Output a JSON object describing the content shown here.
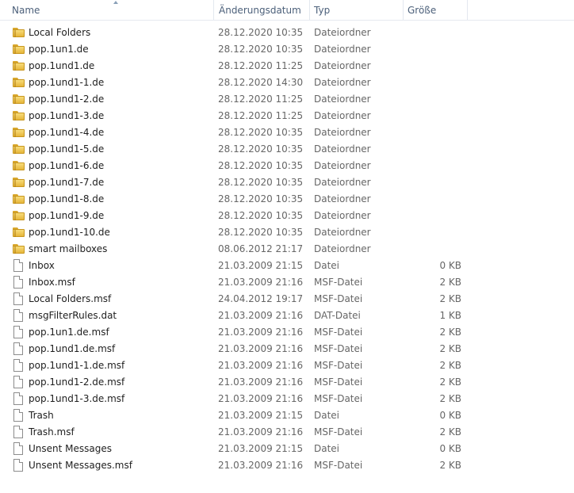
{
  "columns": {
    "name": "Name",
    "date": "Änderungsdatum",
    "type": "Typ",
    "size": "Größe"
  },
  "rows": [
    {
      "icon": "folder-icon",
      "name": "Local Folders",
      "date": "28.12.2020 10:35",
      "type": "Dateiordner",
      "size": ""
    },
    {
      "icon": "folder-icon",
      "name": "pop.1un1.de",
      "date": "28.12.2020 10:35",
      "type": "Dateiordner",
      "size": ""
    },
    {
      "icon": "folder-icon",
      "name": "pop.1und1.de",
      "date": "28.12.2020 11:25",
      "type": "Dateiordner",
      "size": ""
    },
    {
      "icon": "folder-icon",
      "name": "pop.1und1-1.de",
      "date": "28.12.2020 14:30",
      "type": "Dateiordner",
      "size": ""
    },
    {
      "icon": "folder-icon",
      "name": "pop.1und1-2.de",
      "date": "28.12.2020 11:25",
      "type": "Dateiordner",
      "size": ""
    },
    {
      "icon": "folder-icon",
      "name": "pop.1und1-3.de",
      "date": "28.12.2020 11:25",
      "type": "Dateiordner",
      "size": ""
    },
    {
      "icon": "folder-icon",
      "name": "pop.1und1-4.de",
      "date": "28.12.2020 10:35",
      "type": "Dateiordner",
      "size": ""
    },
    {
      "icon": "folder-icon",
      "name": "pop.1und1-5.de",
      "date": "28.12.2020 10:35",
      "type": "Dateiordner",
      "size": ""
    },
    {
      "icon": "folder-icon",
      "name": "pop.1und1-6.de",
      "date": "28.12.2020 10:35",
      "type": "Dateiordner",
      "size": ""
    },
    {
      "icon": "folder-icon",
      "name": "pop.1und1-7.de",
      "date": "28.12.2020 10:35",
      "type": "Dateiordner",
      "size": ""
    },
    {
      "icon": "folder-icon",
      "name": "pop.1und1-8.de",
      "date": "28.12.2020 10:35",
      "type": "Dateiordner",
      "size": ""
    },
    {
      "icon": "folder-icon",
      "name": "pop.1und1-9.de",
      "date": "28.12.2020 10:35",
      "type": "Dateiordner",
      "size": ""
    },
    {
      "icon": "folder-icon",
      "name": "pop.1und1-10.de",
      "date": "28.12.2020 10:35",
      "type": "Dateiordner",
      "size": ""
    },
    {
      "icon": "folder-icon",
      "name": "smart mailboxes",
      "date": "08.06.2012 21:17",
      "type": "Dateiordner",
      "size": ""
    },
    {
      "icon": "file-icon",
      "name": "Inbox",
      "date": "21.03.2009 21:15",
      "type": "Datei",
      "size": "0 KB"
    },
    {
      "icon": "file-icon",
      "name": "Inbox.msf",
      "date": "21.03.2009 21:16",
      "type": "MSF-Datei",
      "size": "2 KB"
    },
    {
      "icon": "file-icon",
      "name": "Local Folders.msf",
      "date": "24.04.2012 19:17",
      "type": "MSF-Datei",
      "size": "2 KB"
    },
    {
      "icon": "file-icon",
      "name": "msgFilterRules.dat",
      "date": "21.03.2009 21:16",
      "type": "DAT-Datei",
      "size": "1 KB"
    },
    {
      "icon": "file-icon",
      "name": "pop.1un1.de.msf",
      "date": "21.03.2009 21:16",
      "type": "MSF-Datei",
      "size": "2 KB"
    },
    {
      "icon": "file-icon",
      "name": "pop.1und1.de.msf",
      "date": "21.03.2009 21:16",
      "type": "MSF-Datei",
      "size": "2 KB"
    },
    {
      "icon": "file-icon",
      "name": "pop.1und1-1.de.msf",
      "date": "21.03.2009 21:16",
      "type": "MSF-Datei",
      "size": "2 KB"
    },
    {
      "icon": "file-icon",
      "name": "pop.1und1-2.de.msf",
      "date": "21.03.2009 21:16",
      "type": "MSF-Datei",
      "size": "2 KB"
    },
    {
      "icon": "file-icon",
      "name": "pop.1und1-3.de.msf",
      "date": "21.03.2009 21:16",
      "type": "MSF-Datei",
      "size": "2 KB"
    },
    {
      "icon": "file-icon",
      "name": "Trash",
      "date": "21.03.2009 21:15",
      "type": "Datei",
      "size": "0 KB"
    },
    {
      "icon": "file-icon",
      "name": "Trash.msf",
      "date": "21.03.2009 21:16",
      "type": "MSF-Datei",
      "size": "2 KB"
    },
    {
      "icon": "file-icon",
      "name": "Unsent Messages",
      "date": "21.03.2009 21:15",
      "type": "Datei",
      "size": "0 KB"
    },
    {
      "icon": "file-icon",
      "name": "Unsent Messages.msf",
      "date": "21.03.2009 21:16",
      "type": "MSF-Datei",
      "size": "2 KB"
    }
  ]
}
